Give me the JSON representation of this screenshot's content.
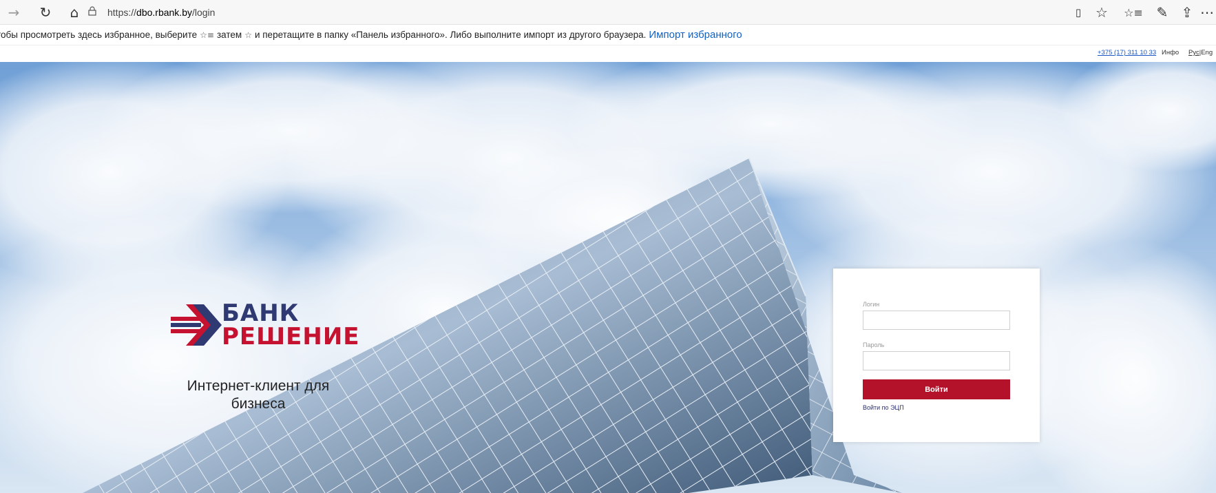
{
  "browser": {
    "url_scheme": "https://",
    "url_host": "dbo.rbank.by",
    "url_path": "/login",
    "icons": {
      "back": "→",
      "refresh": "↻",
      "home": "⌂",
      "lock": "🔒",
      "reading_view": "▯",
      "favorite": "☆",
      "favorites_hub": "☆≡",
      "notes": "✎",
      "share": "⇪",
      "more": "⋯"
    }
  },
  "favorites_bar": {
    "text_before": "Чтобы просмотреть здесь избранное, выберите",
    "text_middle": "затем",
    "text_after": "и перетащите в папку «Панель избранного». Либо выполните импорт из другого браузера.",
    "import_link": "Импорт избранного"
  },
  "site_header": {
    "phone": "+375 (17) 311 10 33",
    "info": "Инфо",
    "lang_ru": "Рус",
    "lang_sep": "|",
    "lang_en": "Eng"
  },
  "brand": {
    "line1": "БАНК",
    "line2": "РЕШЕНИЕ",
    "tagline": "Интернет-клиент для бизнеса"
  },
  "login": {
    "login_label": "Логин",
    "login_value": "",
    "password_label": "Пароль",
    "password_value": "",
    "submit": "Войти",
    "ecp_link": "Войти по ЭЦП"
  },
  "colors": {
    "brand_red": "#b4122a",
    "brand_navy": "#2f3a72",
    "link_blue": "#0f62c4"
  }
}
